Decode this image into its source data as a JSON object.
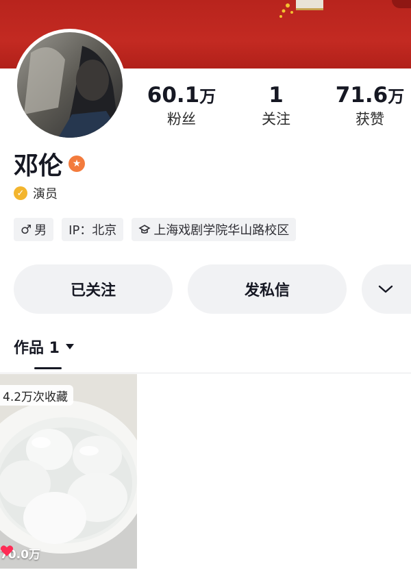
{
  "profile": {
    "name": "邓伦",
    "verification": "演员",
    "avatar_icon": "person-photo"
  },
  "stats": [
    {
      "number": "60.1",
      "unit": "万",
      "label": "粉丝"
    },
    {
      "number": "1",
      "unit": "",
      "label": "关注"
    },
    {
      "number": "71.6",
      "unit": "万",
      "label": "获赞"
    }
  ],
  "tags": {
    "gender_symbol": "♂",
    "gender": "男",
    "ip": "IP：北京",
    "school": "上海戏剧学院华山路校区"
  },
  "actions": {
    "followed_label": "已关注",
    "message_label": "发私信"
  },
  "tab": {
    "label": "作品 1"
  },
  "video": {
    "favorites": "4.2万次收藏",
    "likes": "70.0万"
  },
  "colors": {
    "banner": "#c32a22",
    "badge_orange": "#f37b3d",
    "verify_gold": "#f3b52e",
    "button_bg": "#f1f2f4",
    "like_red": "#fe2c55"
  }
}
